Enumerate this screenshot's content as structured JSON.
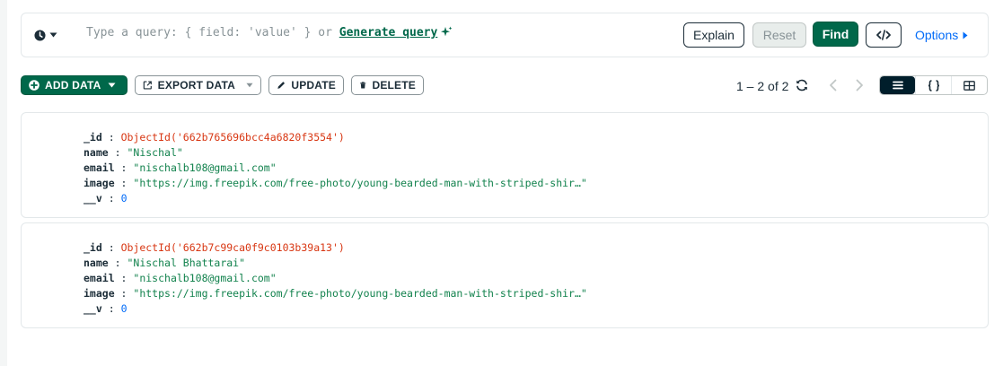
{
  "query_bar": {
    "placeholder": "Type a query: { field: 'value' } or",
    "generate_link": "Generate query",
    "explain_label": "Explain",
    "reset_label": "Reset",
    "find_label": "Find",
    "options_label": "Options"
  },
  "toolbar": {
    "add_data_label": "ADD DATA",
    "export_data_label": "EXPORT DATA",
    "update_label": "UPDATE",
    "delete_label": "DELETE"
  },
  "pagination": {
    "text": "1 – 2 of 2"
  },
  "view_toggle": {
    "selected": "list",
    "options": [
      "list",
      "json",
      "table"
    ]
  },
  "documents": [
    {
      "id_key": "_id",
      "id_value": "ObjectId('662b765696bcc4a6820f3554')",
      "name_key": "name",
      "name_value": "\"Nischal\"",
      "email_key": "email",
      "email_value": "\"nischalb108@gmail.com\"",
      "image_key": "image",
      "image_value": "\"https://img.freepik.com/free-photo/young-bearded-man-with-striped-shir…\"",
      "v_key": "__v",
      "v_value": "0"
    },
    {
      "id_key": "_id",
      "id_value": "ObjectId('662b7c99ca0f9c0103b39a13')",
      "name_key": "name",
      "name_value": "\"Nischal Bhattarai\"",
      "email_key": "email",
      "email_value": "\"nischalb108@gmail.com\"",
      "image_key": "image",
      "image_value": "\"https://img.freepik.com/free-photo/young-bearded-man-with-striped-shir…\"",
      "v_key": "__v",
      "v_value": "0"
    }
  ],
  "colors": {
    "brand_green": "#00684a",
    "link_blue": "#016bf8",
    "objectid_red": "#d83713",
    "string_green": "#12824d",
    "dark_navy": "#001e2b"
  },
  "icons": [
    "clock-icon",
    "caret-down-icon",
    "sparkle-icon",
    "code-icon",
    "triangle-right-icon",
    "plus-circle-icon",
    "export-icon",
    "pencil-icon",
    "trash-icon",
    "refresh-icon",
    "chevron-left-icon",
    "chevron-right-icon",
    "list-icon",
    "braces-icon",
    "table-icon"
  ]
}
